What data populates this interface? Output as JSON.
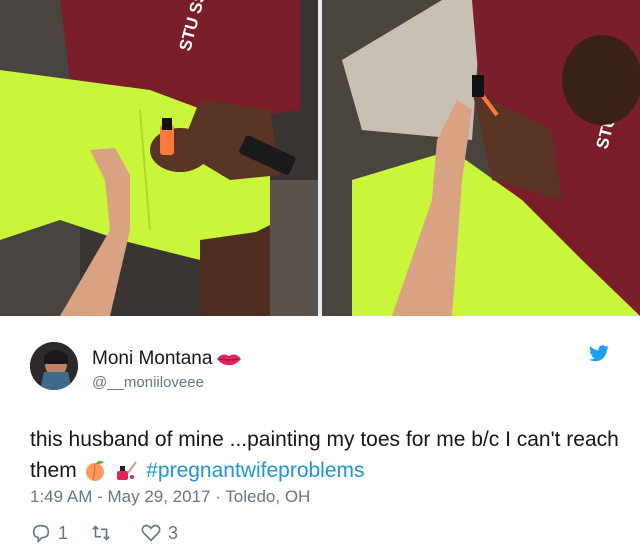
{
  "photos": {
    "left_shirt_print": "STU SSY",
    "right_shirt_print": "STU SSY"
  },
  "tweet": {
    "display_name": "Moni Montana",
    "handle": "@__moniiloveee",
    "text_part1": "this husband of mine ...painting my toes for me b/c I can't reach them",
    "hashtag": "#pregnantwifeproblems",
    "meta": "1:49 AM - May 29, 2017 · Toledo, OH",
    "reply_count": "1",
    "like_count": "3"
  },
  "icons": {
    "lips": "kiss-mark-icon",
    "bird": "twitter-bird-icon",
    "peach": "peach-icon",
    "nail_polish": "nail-polish-icon",
    "reply": "reply-icon",
    "retweet": "retweet-icon",
    "like": "heart-icon"
  },
  "colors": {
    "hashtag": "#1b95e0",
    "meta_gray": "#657786",
    "twitter_blue": "#1da1f2",
    "shorts_neon": "#c9f53a",
    "shirt_maroon": "#7a1e2a"
  }
}
